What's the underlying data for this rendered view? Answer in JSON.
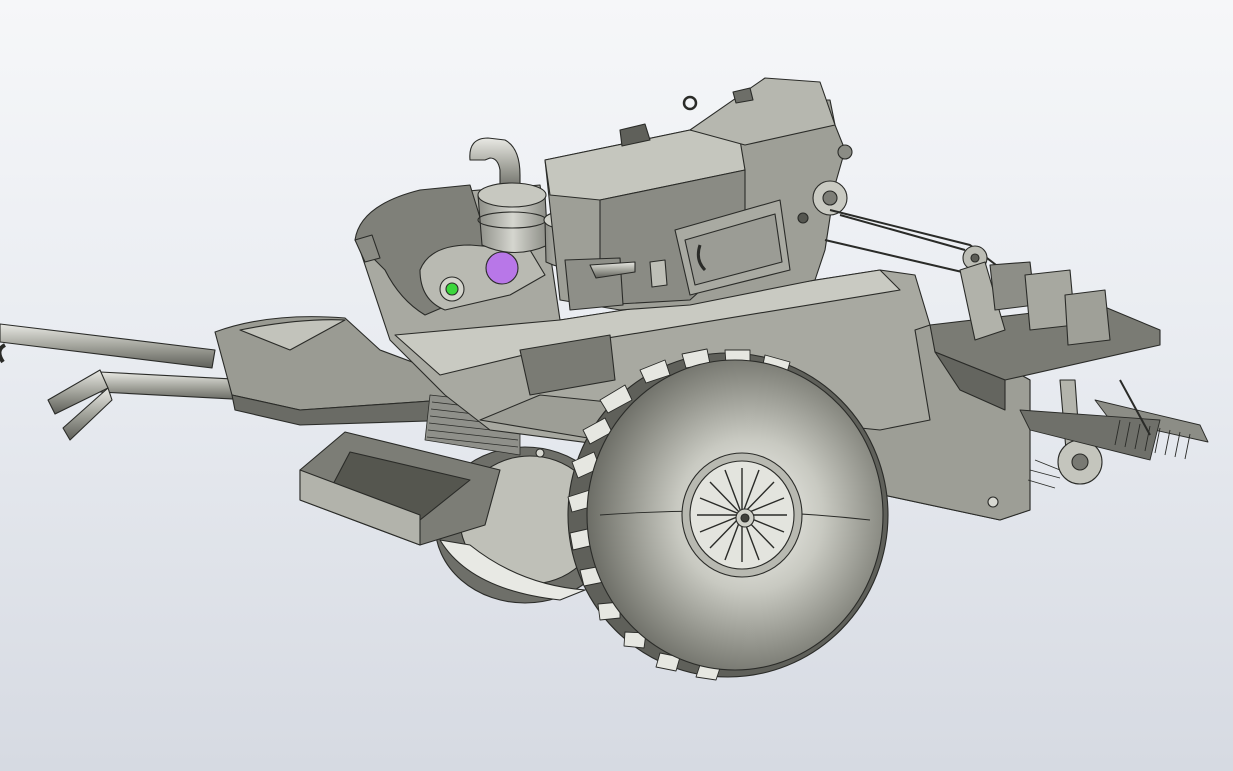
{
  "viewport": {
    "background_top": "#f6f7f9",
    "background_bottom": "#d6dae2"
  },
  "model": {
    "body_color": "#a4a59c",
    "shadow_color": "#5f605a",
    "highlight_color": "#e4e5e0",
    "outline_color": "#2a2b28",
    "selected_feature_color": "#b877e8",
    "indicator_color": "#3cd63c"
  }
}
